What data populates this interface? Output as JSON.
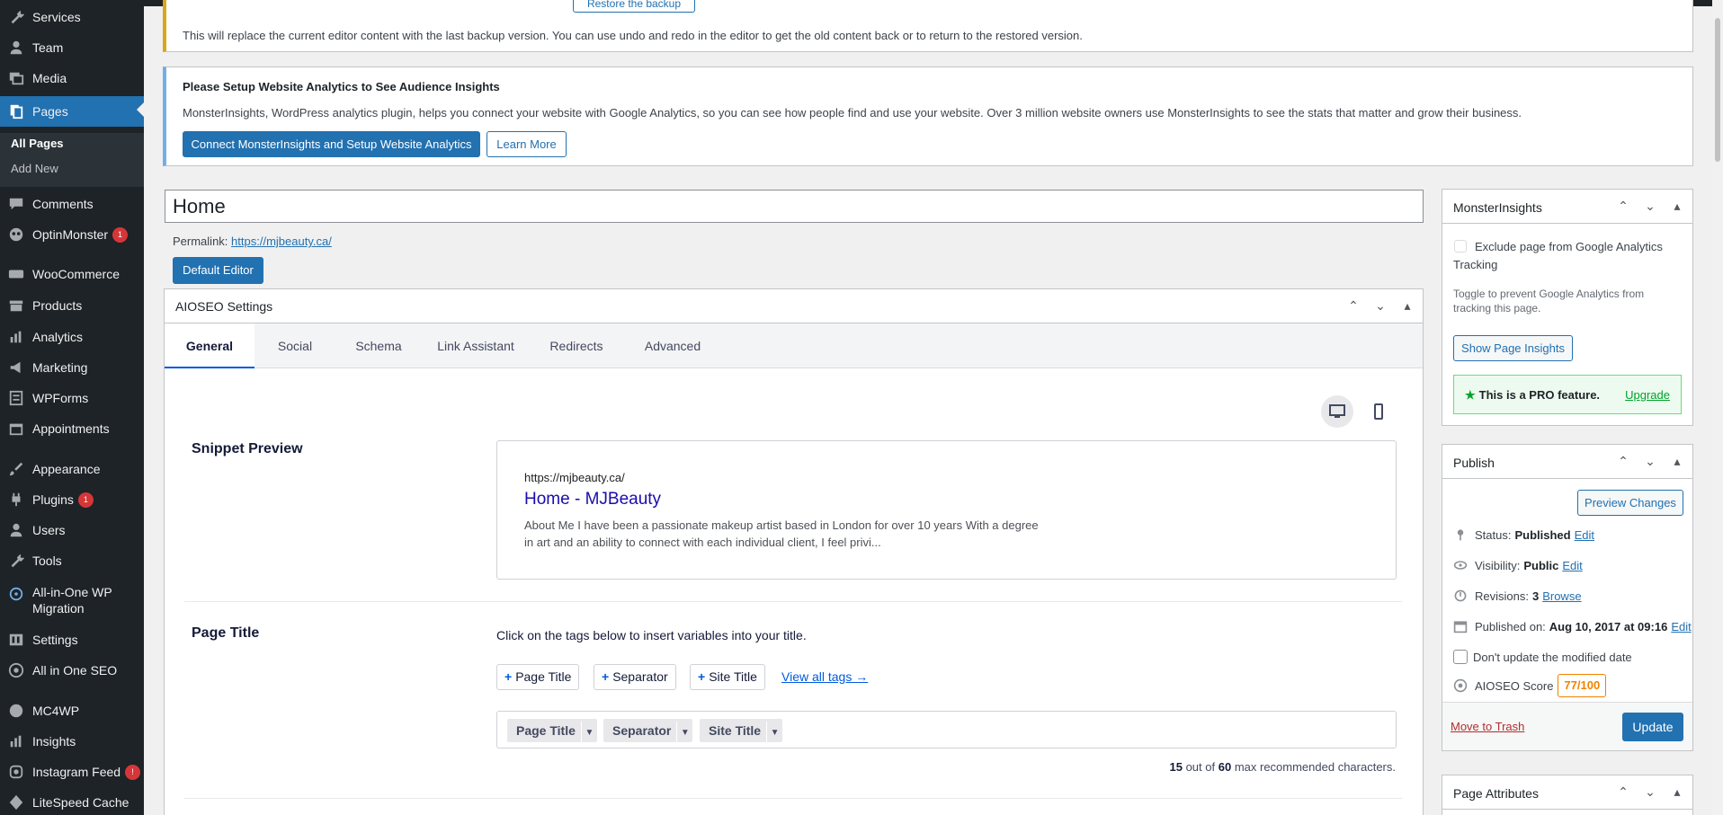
{
  "sidebar": {
    "items": [
      {
        "label": "Services",
        "icon": "wrench-icon"
      },
      {
        "label": "Team",
        "icon": "user-icon"
      },
      {
        "label": "Media",
        "icon": "media-icon"
      },
      {
        "label": "Pages",
        "icon": "pages-icon"
      },
      {
        "label": "Comments",
        "icon": "comment-icon"
      },
      {
        "label": "OptinMonster",
        "icon": "optinmonster-icon",
        "badge": "1"
      },
      {
        "label": "WooCommerce",
        "icon": "woo-icon"
      },
      {
        "label": "Products",
        "icon": "archive-icon"
      },
      {
        "label": "Analytics",
        "icon": "bar-chart-icon"
      },
      {
        "label": "Marketing",
        "icon": "megaphone-icon"
      },
      {
        "label": "WPForms",
        "icon": "forms-icon"
      },
      {
        "label": "Appointments",
        "icon": "calendar-icon"
      },
      {
        "label": "Appearance",
        "icon": "paintbrush-icon"
      },
      {
        "label": "Plugins",
        "icon": "plugin-icon",
        "badge": "1"
      },
      {
        "label": "Users",
        "icon": "users-icon"
      },
      {
        "label": "Tools",
        "icon": "tools-icon"
      },
      {
        "label": "All-in-One WP",
        "label2": "Migration",
        "icon": "migration-icon"
      },
      {
        "label": "Settings",
        "icon": "settings-icon"
      },
      {
        "label": "All in One SEO",
        "icon": "seo-icon"
      },
      {
        "label": "MC4WP",
        "icon": "mail-icon"
      },
      {
        "label": "Insights",
        "icon": "insights-icon"
      },
      {
        "label": "Instagram Feed",
        "icon": "instagram-icon",
        "badge": "!"
      },
      {
        "label": "LiteSpeed Cache",
        "icon": "litespeed-icon"
      }
    ],
    "submenu": {
      "all_pages": "All Pages",
      "add_new": "Add New"
    }
  },
  "notices": {
    "backup_text": "This will replace the current editor content with the last backup version. You can use undo and redo in the editor to get the old content back or to return to the restored version.",
    "backup_button": "Restore the backup",
    "analytics_title": "Please Setup Website Analytics to See Audience Insights",
    "analytics_desc": "MonsterInsights, WordPress analytics plugin, helps you connect your website with Google Analytics, so you can see how people find and use your website. Over 3 million website owners use MonsterInsights to see the stats that matter and grow their business.",
    "connect_button": "Connect MonsterInsights and Setup Website Analytics",
    "learn_more": "Learn More"
  },
  "editor": {
    "title": "Home",
    "permalink_label": "Permalink:",
    "permalink_url": "https://mjbeauty.ca/",
    "default_editor": "Default Editor"
  },
  "aioseo": {
    "header": "AIOSEO Settings",
    "tabs": [
      "General",
      "Social",
      "Schema",
      "Link Assistant",
      "Redirects",
      "Advanced"
    ],
    "snippet_label": "Snippet Preview",
    "snippet_url": "https://mjbeauty.ca/",
    "snippet_title": "Home - MJBeauty",
    "snippet_desc": "About Me I have been a passionate makeup artist based in London for over 10 years With a degree in art and an ability to connect with each individual client, I feel privi...",
    "page_title_label": "Page Title",
    "hint": "Click on the tags below to insert variables into your title.",
    "tag_buttons": [
      "Page Title",
      "Separator",
      "Site Title"
    ],
    "view_all": "View all tags →",
    "chips": [
      "Page Title",
      "Separator",
      "Site Title"
    ],
    "count_current": "15",
    "count_out_of": "out of",
    "count_max": "60",
    "count_suffix": "max recommended characters."
  },
  "monsterinsights": {
    "header": "MonsterInsights",
    "exclude_label": "Exclude page from Google Analytics Tracking",
    "toggle_hint": "Toggle to prevent Google Analytics from tracking this page.",
    "insights_button": "Show Page Insights",
    "pro_text": "This is a PRO feature.",
    "upgrade": "Upgrade"
  },
  "publish": {
    "header": "Publish",
    "preview_button": "Preview Changes",
    "status_label": "Status:",
    "status_value": "Published",
    "edit": "Edit",
    "visibility_label": "Visibility:",
    "visibility_value": "Public",
    "revisions_label": "Revisions:",
    "revisions_value": "3",
    "browse": "Browse",
    "published_label": "Published on:",
    "published_value": "Aug 10, 2017 at 09:16",
    "dont_update": "Don't update the modified date",
    "aioseo_score_label": "AIOSEO Score",
    "aioseo_score": "77/100",
    "trash": "Move to Trash",
    "update": "Update"
  },
  "page_attributes": {
    "header": "Page Attributes"
  },
  "colors": {
    "wp_blue": "#2271b1",
    "sidebar_bg": "#1d2327",
    "score_orange": "#f18200",
    "pro_green": "#00a32a"
  }
}
